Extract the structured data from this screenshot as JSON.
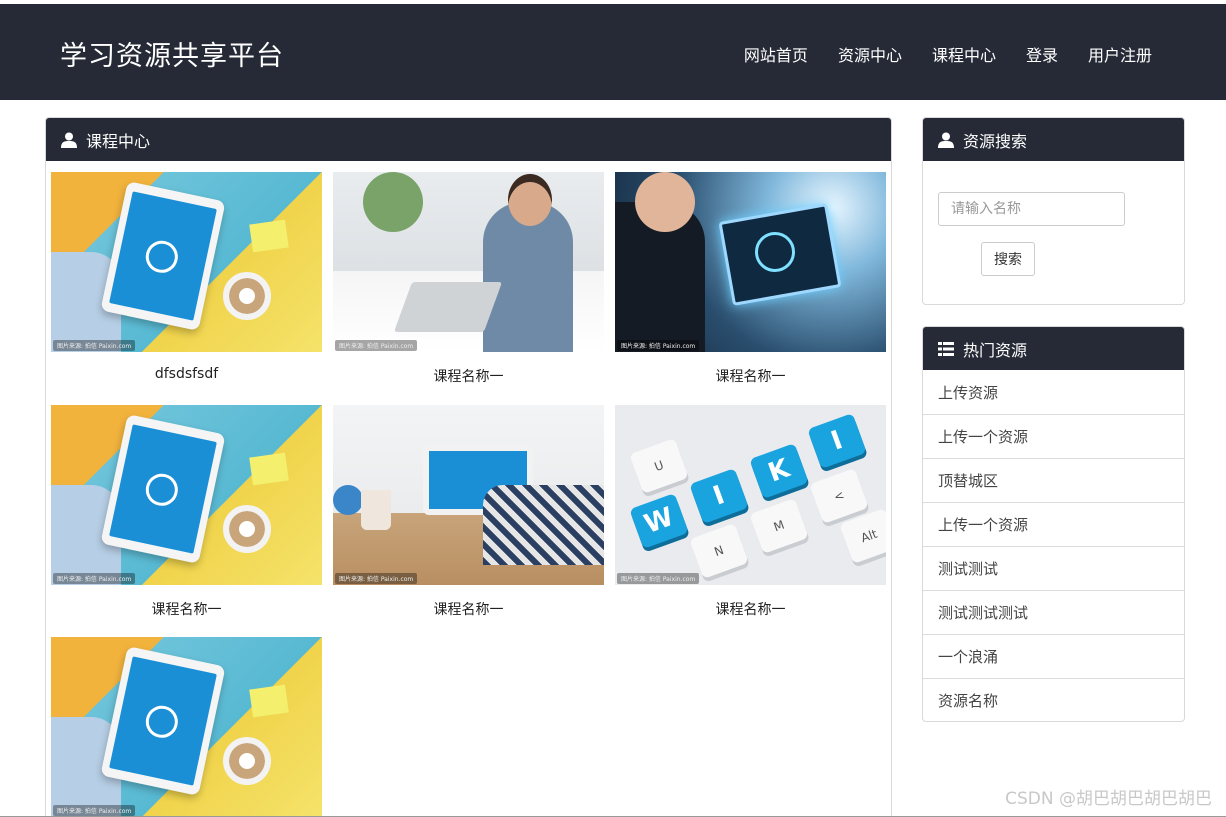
{
  "header": {
    "brand": "学习资源共享平台",
    "nav": [
      "网站首页",
      "资源中心",
      "课程中心",
      "登录",
      "用户注册"
    ]
  },
  "main": {
    "title": "课程中心",
    "courses": [
      {
        "title": "dfsdsfsdf",
        "image": "tablet-dictionary"
      },
      {
        "title": "课程名称一",
        "image": "office-laptop"
      },
      {
        "title": "课程名称一",
        "image": "online-learning"
      },
      {
        "title": "课程名称一",
        "image": "online-university-tablet"
      },
      {
        "title": "课程名称一",
        "image": "online-university-laptop"
      },
      {
        "title": "课程名称一",
        "image": "wiki-keyboard"
      },
      {
        "title": "",
        "image": "tablet-dictionary"
      }
    ]
  },
  "search": {
    "title": "资源搜索",
    "placeholder": "请输入名称",
    "button": "搜索"
  },
  "hot": {
    "title": "热门资源",
    "items": [
      "上传资源",
      "上传一个资源",
      "顶替城区",
      "上传一个资源",
      "测试测试",
      "测试测试测试",
      "一个浪涌",
      "资源名称"
    ]
  },
  "watermark": "CSDN @胡巴胡巴胡巴胡巴",
  "colors": {
    "header_bg": "#252a36",
    "accent_blue": "#1a8fd6"
  }
}
